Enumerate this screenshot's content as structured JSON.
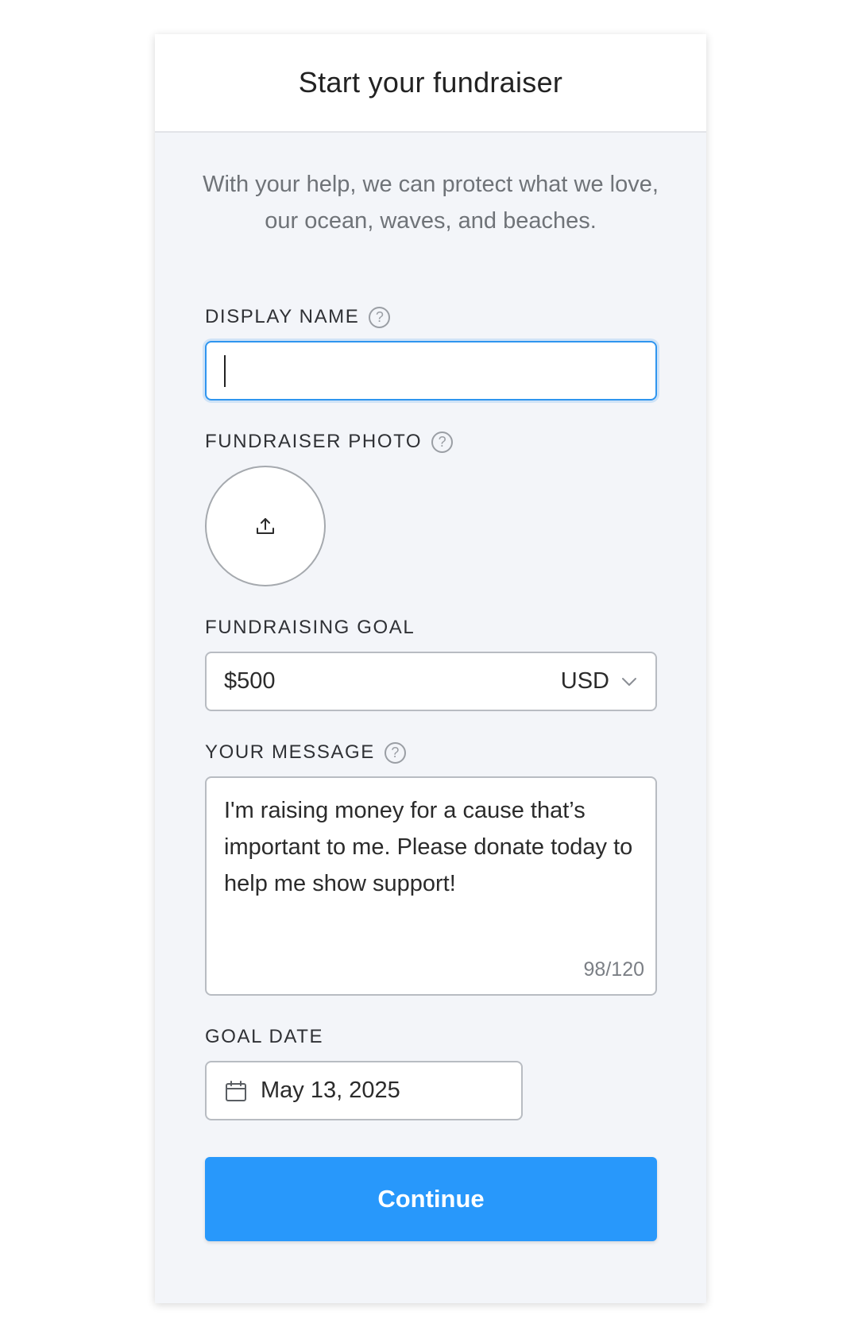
{
  "header": {
    "title": "Start your fundraiser"
  },
  "intro": {
    "text": "With your help, we can protect what we love, our ocean, waves, and beaches."
  },
  "fields": {
    "display_name": {
      "label": "DISPLAY NAME",
      "help_icon": "question-circle-icon",
      "value": ""
    },
    "photo": {
      "label": "FUNDRAISER PHOTO",
      "help_icon": "question-circle-icon",
      "upload_icon": "upload-icon"
    },
    "goal": {
      "label": "FUNDRAISING GOAL",
      "value": "$500",
      "currency": "USD",
      "dropdown_icon": "chevron-down-icon"
    },
    "message": {
      "label": "YOUR MESSAGE",
      "help_icon": "question-circle-icon",
      "value": "I'm raising money for a cause that’s important to me. Please donate today to help me show support!",
      "counter": "98/120"
    },
    "goal_date": {
      "label": "GOAL DATE",
      "value": "May 13, 2025",
      "icon": "calendar-icon"
    }
  },
  "actions": {
    "continue_label": "Continue"
  },
  "colors": {
    "accent": "#2898fb",
    "focus_border": "#2f95ef",
    "card_bg": "#f3f5f9"
  }
}
